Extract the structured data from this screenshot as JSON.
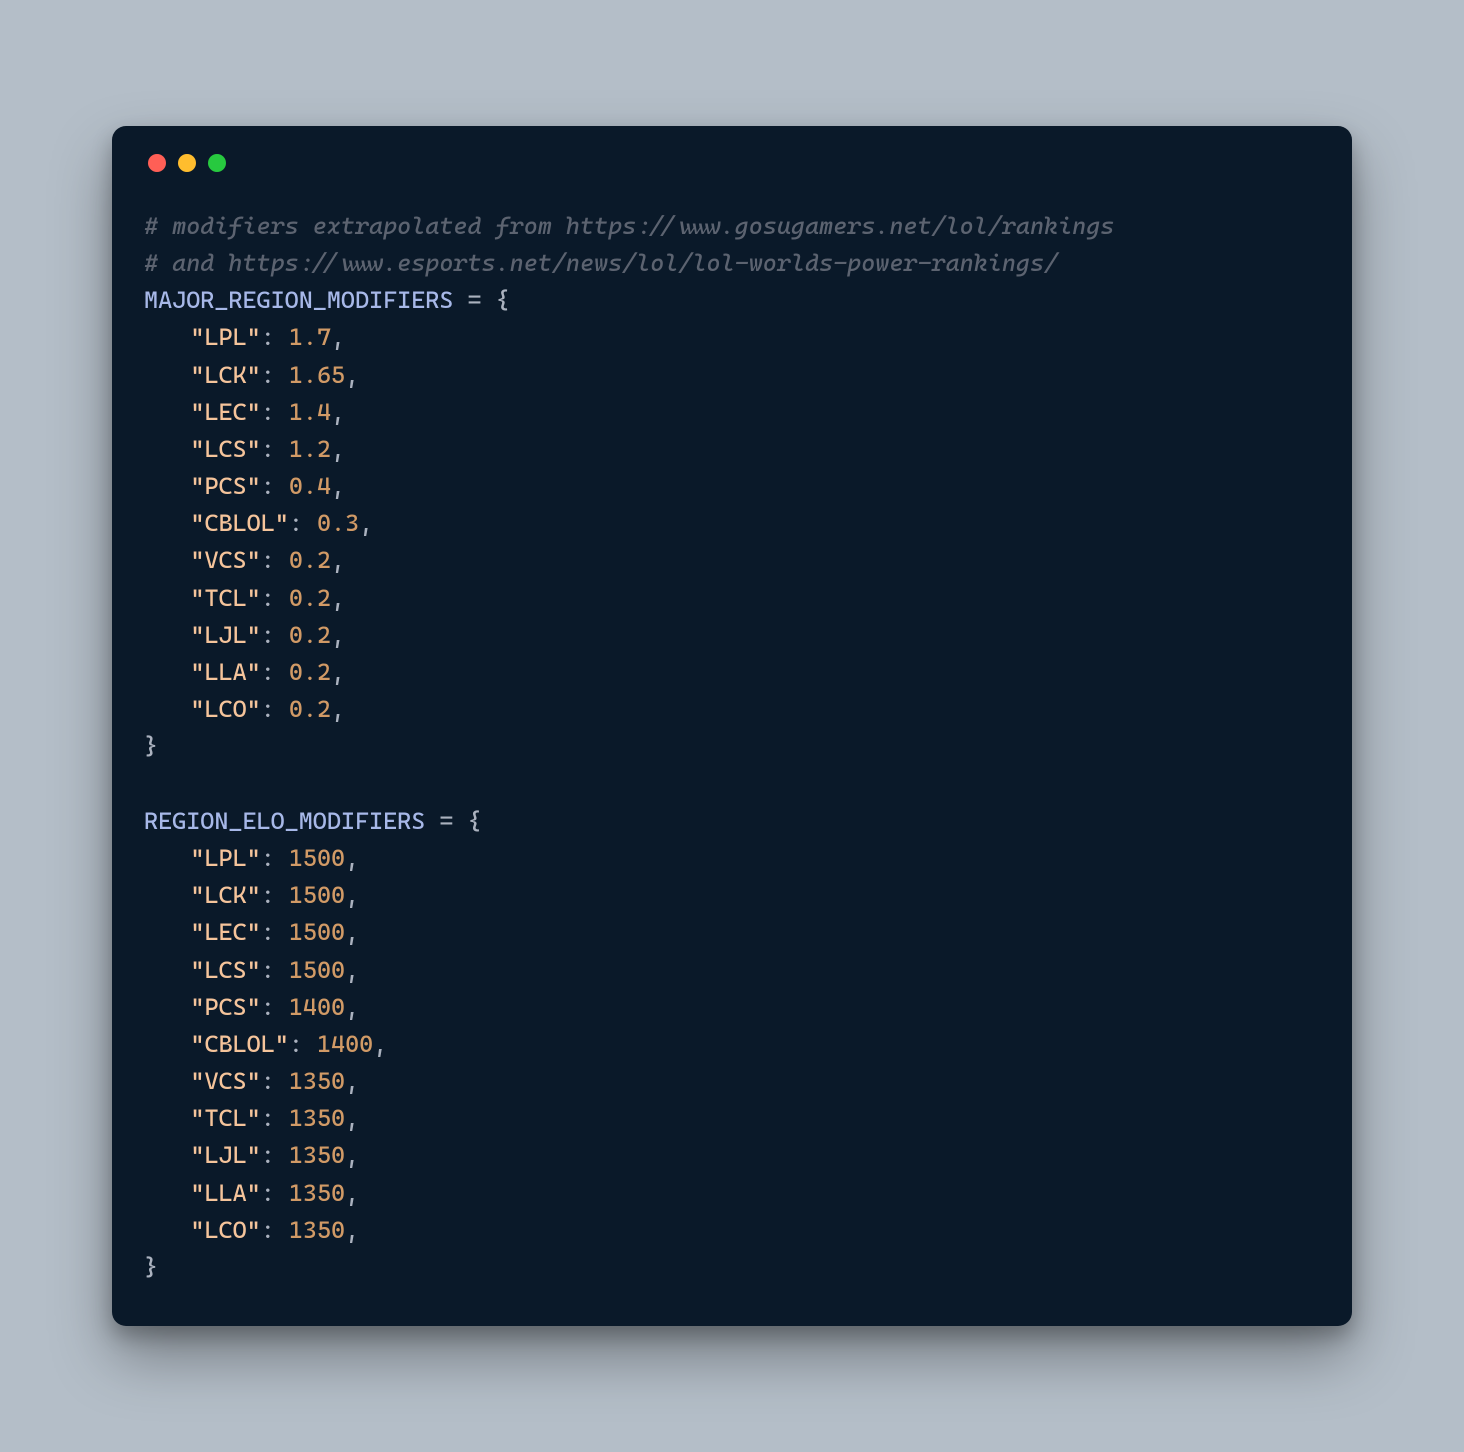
{
  "window": {
    "traffic_lights": [
      "close",
      "minimize",
      "maximize"
    ]
  },
  "comments": [
    "# modifiers extrapolated from https://www.gosugamers.net/lol/rankings",
    "# and https://www.esports.net/news/lol/lol-worlds-power-rankings/"
  ],
  "dicts": [
    {
      "name": "MAJOR_REGION_MODIFIERS",
      "entries": [
        {
          "key": "LPL",
          "value": "1.7"
        },
        {
          "key": "LCK",
          "value": "1.65"
        },
        {
          "key": "LEC",
          "value": "1.4"
        },
        {
          "key": "LCS",
          "value": "1.2"
        },
        {
          "key": "PCS",
          "value": "0.4"
        },
        {
          "key": "CBLOL",
          "value": "0.3"
        },
        {
          "key": "VCS",
          "value": "0.2"
        },
        {
          "key": "TCL",
          "value": "0.2"
        },
        {
          "key": "LJL",
          "value": "0.2"
        },
        {
          "key": "LLA",
          "value": "0.2"
        },
        {
          "key": "LCO",
          "value": "0.2"
        }
      ]
    },
    {
      "name": "REGION_ELO_MODIFIERS",
      "entries": [
        {
          "key": "LPL",
          "value": "1500"
        },
        {
          "key": "LCK",
          "value": "1500"
        },
        {
          "key": "LEC",
          "value": "1500"
        },
        {
          "key": "LCS",
          "value": "1500"
        },
        {
          "key": "PCS",
          "value": "1400"
        },
        {
          "key": "CBLOL",
          "value": "1400"
        },
        {
          "key": "VCS",
          "value": "1350"
        },
        {
          "key": "TCL",
          "value": "1350"
        },
        {
          "key": "LJL",
          "value": "1350"
        },
        {
          "key": "LLA",
          "value": "1350"
        },
        {
          "key": "LCO",
          "value": "1350"
        }
      ]
    }
  ]
}
